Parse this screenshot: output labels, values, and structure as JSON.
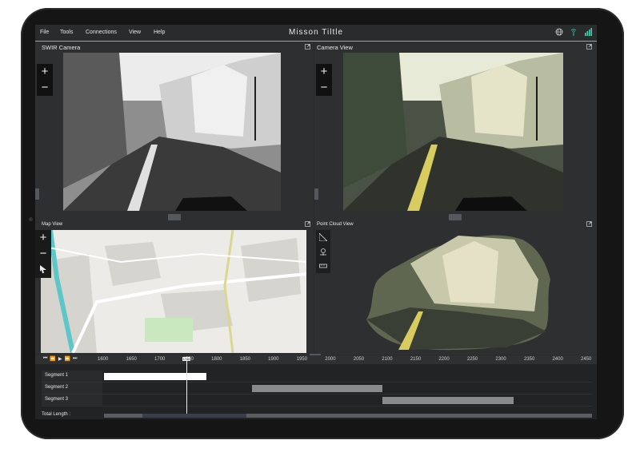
{
  "menu": [
    "File",
    "Tools",
    "Connections",
    "View",
    "Help"
  ],
  "app_title": "Misson Tiltle",
  "icons": {
    "globe": "globe-icon",
    "signal": "signal-icon",
    "bars": "signal-bars-icon",
    "expand": "expand-icon",
    "zoom_in": "+",
    "zoom_out": "−"
  },
  "colors": {
    "accent": "#3fd4b4",
    "seg_active": "#ffffff",
    "seg_inactive": "#8a8a8a"
  },
  "panels": {
    "swir": {
      "title": "SWIR Camera"
    },
    "camera": {
      "title": "Camera View"
    },
    "map": {
      "title": "Map View"
    },
    "pointcloud": {
      "title": "Point Cloud View"
    }
  },
  "timeline": {
    "ticks": [
      "1600",
      "1650",
      "1700",
      "1750",
      "1800",
      "1850",
      "1900",
      "1950",
      "2000",
      "2050",
      "2100",
      "2150",
      "2200",
      "2250",
      "2300",
      "2350",
      "2400",
      "2450"
    ],
    "cursor_label": "1746",
    "segments": [
      {
        "label": "Segment 1",
        "start": 1600,
        "end": 1780,
        "active": true
      },
      {
        "label": "Segment 2",
        "start": 1860,
        "end": 2090,
        "active": false
      },
      {
        "label": "Segment 3",
        "start": 2090,
        "end": 2320,
        "active": false
      }
    ],
    "total_label": "Total Length :"
  }
}
